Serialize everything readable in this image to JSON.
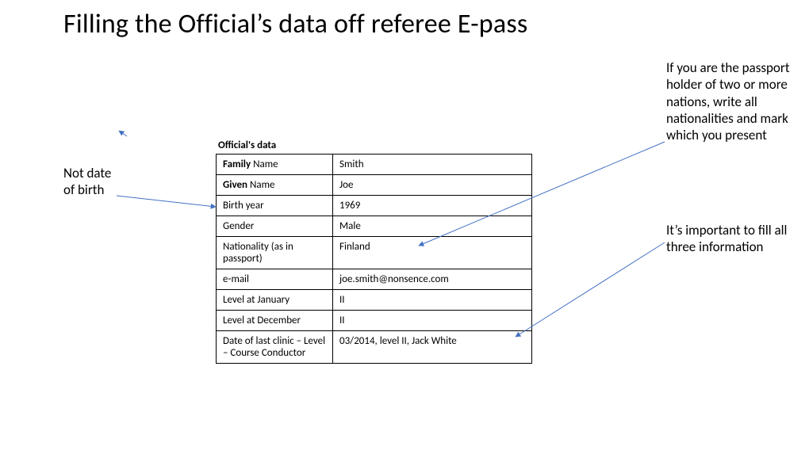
{
  "title": "Filling the Official’s data off referee E-pass",
  "table_heading": "Official's data",
  "rows": [
    {
      "label_bold": "Family",
      "label_rest": " Name",
      "value": "Smith"
    },
    {
      "label_bold": "Given",
      "label_rest": " Name",
      "value": "Joe"
    },
    {
      "label_bold": "",
      "label_rest": "Birth year",
      "value": "1969"
    },
    {
      "label_bold": "",
      "label_rest": "Gender",
      "value": "Male"
    },
    {
      "label_bold": "",
      "label_rest": "Nationality (as in passport)",
      "value": "Finland"
    },
    {
      "label_bold": "",
      "label_rest": "e-mail",
      "value": "joe.smith@nonsence.com"
    },
    {
      "label_bold": "",
      "label_rest": "Level at January",
      "value": "II"
    },
    {
      "label_bold": "",
      "label_rest": "Level at December",
      "value": "II"
    },
    {
      "label_bold": "",
      "label_rest": "Date of last clinic – Level – Course Conductor",
      "value": "03/2014, level II, Jack White"
    }
  ],
  "notes": {
    "left": "Not date of birth",
    "top_right": "If you are the passport holder of two or more nations, write all nationalities and mark which you present",
    "bottom_right": "It’s important to fill all three information"
  }
}
